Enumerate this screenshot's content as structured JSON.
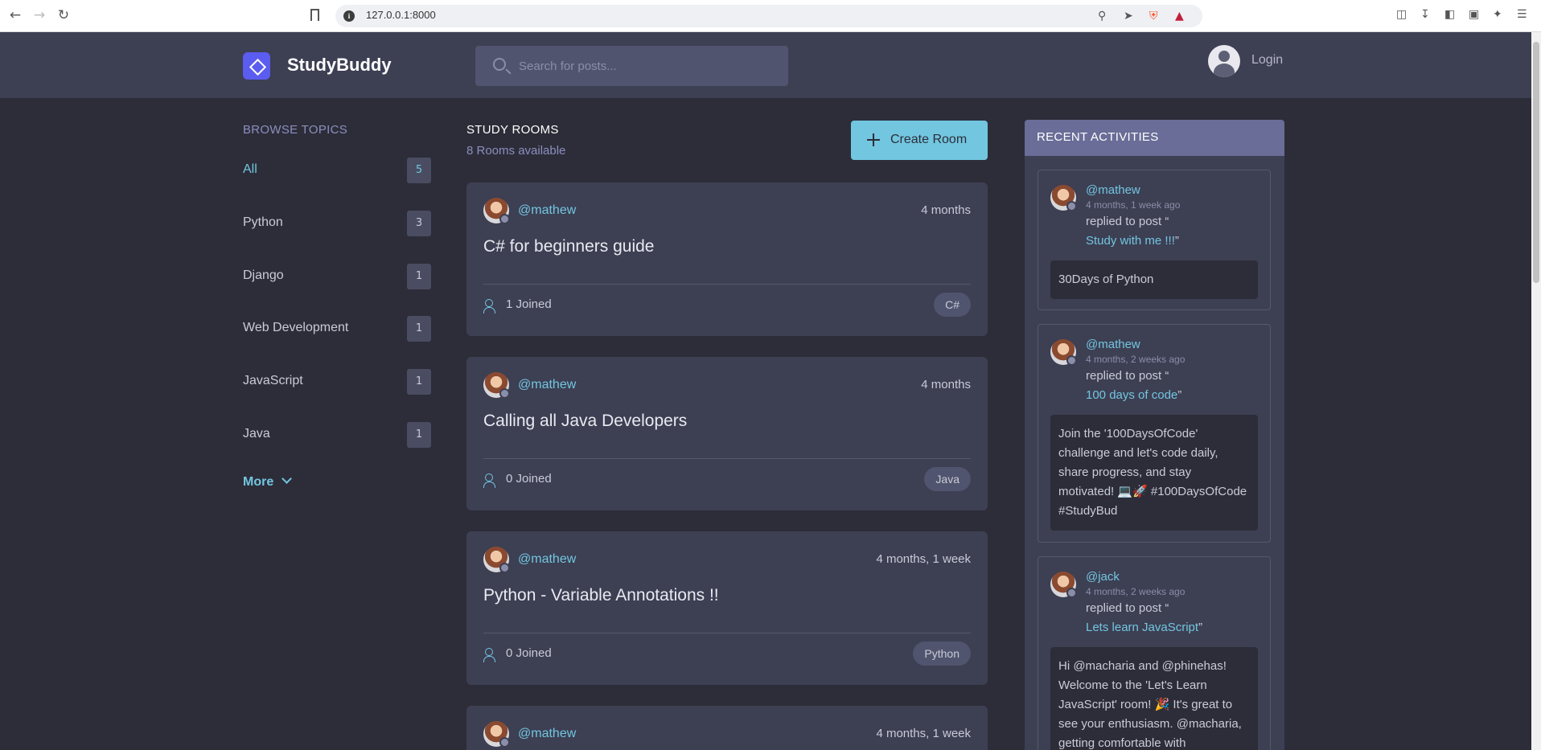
{
  "browser": {
    "url": "127.0.0.1:8000"
  },
  "header": {
    "brand": "StudyBuddy",
    "search_placeholder": "Search for posts...",
    "login_label": "Login"
  },
  "topics": {
    "title": "BROWSE TOPICS",
    "items": [
      {
        "label": "All",
        "count": "5"
      },
      {
        "label": "Python",
        "count": "3"
      },
      {
        "label": "Django",
        "count": "1"
      },
      {
        "label": "Web Development",
        "count": "1"
      },
      {
        "label": "JavaScript",
        "count": "1"
      },
      {
        "label": "Java",
        "count": "1"
      }
    ],
    "more_label": "More"
  },
  "rooms": {
    "title": "STUDY ROOMS",
    "subtitle": "8 Rooms available",
    "create_label": "Create Room",
    "items": [
      {
        "host": "@mathew",
        "time": "4 months",
        "name": "C# for beginners guide",
        "joined": "1 Joined",
        "tag": "C#"
      },
      {
        "host": "@mathew",
        "time": "4 months",
        "name": "Calling all Java Developers",
        "joined": "0 Joined",
        "tag": "Java"
      },
      {
        "host": "@mathew",
        "time": "4 months, 1 week",
        "name": "Python - Variable Annotations !!",
        "joined": "0 Joined",
        "tag": "Python"
      },
      {
        "host": "@mathew",
        "time": "4 months, 1 week",
        "name": "",
        "joined": "",
        "tag": ""
      }
    ]
  },
  "activity": {
    "title": "RECENT ACTIVITIES",
    "items": [
      {
        "user": "@mathew",
        "ago": "4 months, 1 week ago",
        "verb": "replied to post “",
        "post": "Study with me !!!",
        "close": "”",
        "body": "30Days of Python"
      },
      {
        "user": "@mathew",
        "ago": "4 months, 2 weeks ago",
        "verb": "replied to post “",
        "post": "100 days of code",
        "close": "”",
        "body": "Join the '100DaysOfCode' challenge and let's code daily, share progress, and stay motivated! 💻🚀 #100DaysOfCode #StudyBud"
      },
      {
        "user": "@jack",
        "ago": "4 months, 2 weeks ago",
        "verb": "replied to post “",
        "post": "Lets learn JavaScript",
        "close": "”",
        "body": "Hi @macharia and @phinehas! Welcome to the 'Let's Learn JavaScript' room! 🎉 It's great to see your enthusiasm. @macharia, getting comfortable with"
      }
    ]
  }
}
